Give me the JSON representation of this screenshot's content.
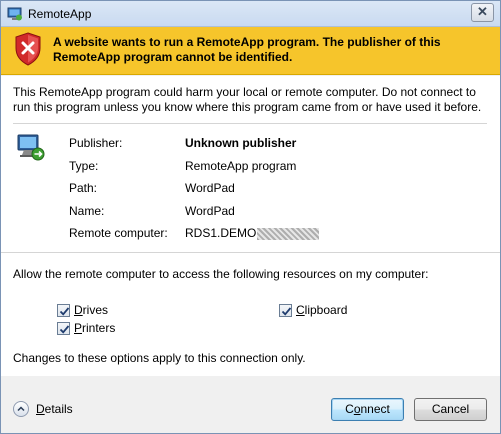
{
  "window": {
    "title": "RemoteApp",
    "close_symbol": "✕"
  },
  "banner": {
    "text": "A website wants to run a RemoteApp program. The publisher of this RemoteApp program cannot be identified."
  },
  "intro": "This RemoteApp program could harm your local or remote computer. Do not connect to run this program unless you know where this program came from or have used it before.",
  "properties": [
    {
      "label": "Publisher:",
      "value": "Unknown publisher"
    },
    {
      "label": "Type:",
      "value": "RemoteApp program"
    },
    {
      "label": "Path:",
      "value": "WordPad"
    },
    {
      "label": "Name:",
      "value": "WordPad"
    },
    {
      "label": "Remote computer:",
      "value": "RDS1.DEMO"
    }
  ],
  "resources": {
    "prompt": "Allow the remote computer to access the following resources on my computer:",
    "drives": {
      "pre": "",
      "key": "D",
      "post": "rives",
      "checked": true
    },
    "clipboard": {
      "pre": "",
      "key": "C",
      "post": "lipboard",
      "checked": true
    },
    "printers": {
      "pre": "",
      "key": "P",
      "post": "rinters",
      "checked": true
    },
    "note": "Changes to these options apply to this connection only."
  },
  "footer": {
    "details": {
      "pre": "",
      "key": "D",
      "post": "etails"
    },
    "connect": {
      "pre": "C",
      "key": "o",
      "post": "nnect"
    },
    "cancel_label": "Cancel"
  },
  "colors": {
    "banner": "#f6c52b",
    "shield_red": "#d12a2a",
    "default_button": "#3c7fb1"
  }
}
